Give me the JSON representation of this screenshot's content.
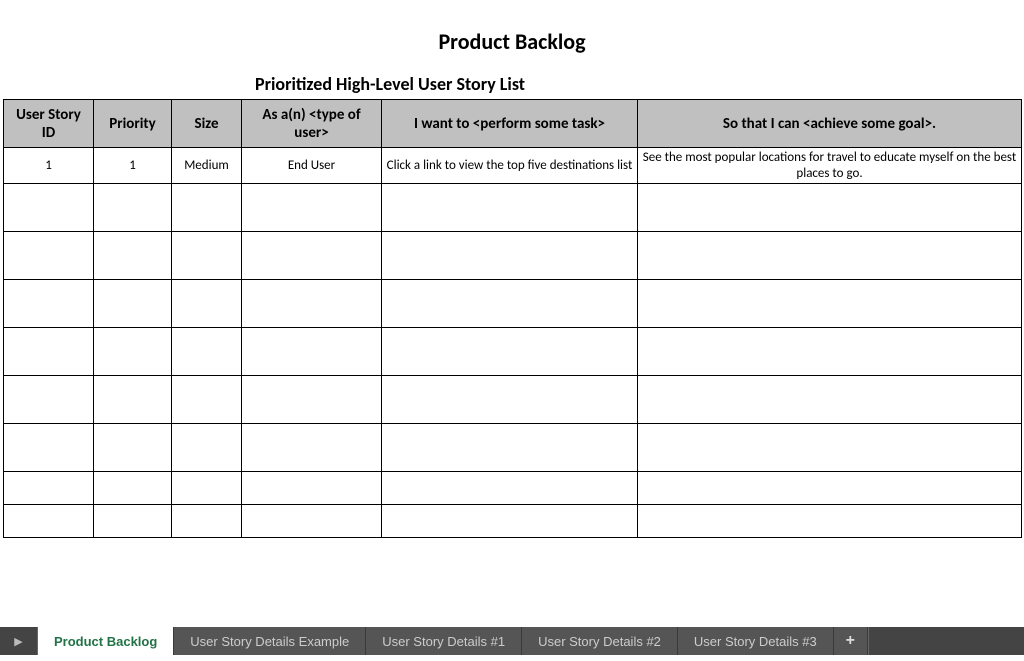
{
  "title": "Product Backlog",
  "subtitle": "Prioritized High-Level User Story List",
  "columns": [
    "User Story ID",
    "Priority",
    "Size",
    "As a(n) <type of user>",
    "I want to <perform some task>",
    "So that I can <achieve some goal>."
  ],
  "rows": [
    {
      "id": "1",
      "priority": "1",
      "size": "Medium",
      "user_type": "End User",
      "task": "Click a link to view the top five destinations list",
      "goal": "See the most popular locations for travel to educate myself on the best places to go."
    },
    {
      "id": "",
      "priority": "",
      "size": "",
      "user_type": "",
      "task": "",
      "goal": ""
    },
    {
      "id": "",
      "priority": "",
      "size": "",
      "user_type": "",
      "task": "",
      "goal": ""
    },
    {
      "id": "",
      "priority": "",
      "size": "",
      "user_type": "",
      "task": "",
      "goal": ""
    },
    {
      "id": "",
      "priority": "",
      "size": "",
      "user_type": "",
      "task": "",
      "goal": ""
    },
    {
      "id": "",
      "priority": "",
      "size": "",
      "user_type": "",
      "task": "",
      "goal": ""
    },
    {
      "id": "",
      "priority": "",
      "size": "",
      "user_type": "",
      "task": "",
      "goal": ""
    },
    {
      "id": "",
      "priority": "",
      "size": "",
      "user_type": "",
      "task": "",
      "goal": ""
    },
    {
      "id": "",
      "priority": "",
      "size": "",
      "user_type": "",
      "task": "",
      "goal": ""
    }
  ],
  "tabs": {
    "items": [
      "Product Backlog",
      "User Story Details Example",
      "User Story Details #1",
      "User Story Details #2",
      "User Story Details #3"
    ],
    "active_index": 0,
    "add_label": "+"
  },
  "nav_icon": "▶"
}
